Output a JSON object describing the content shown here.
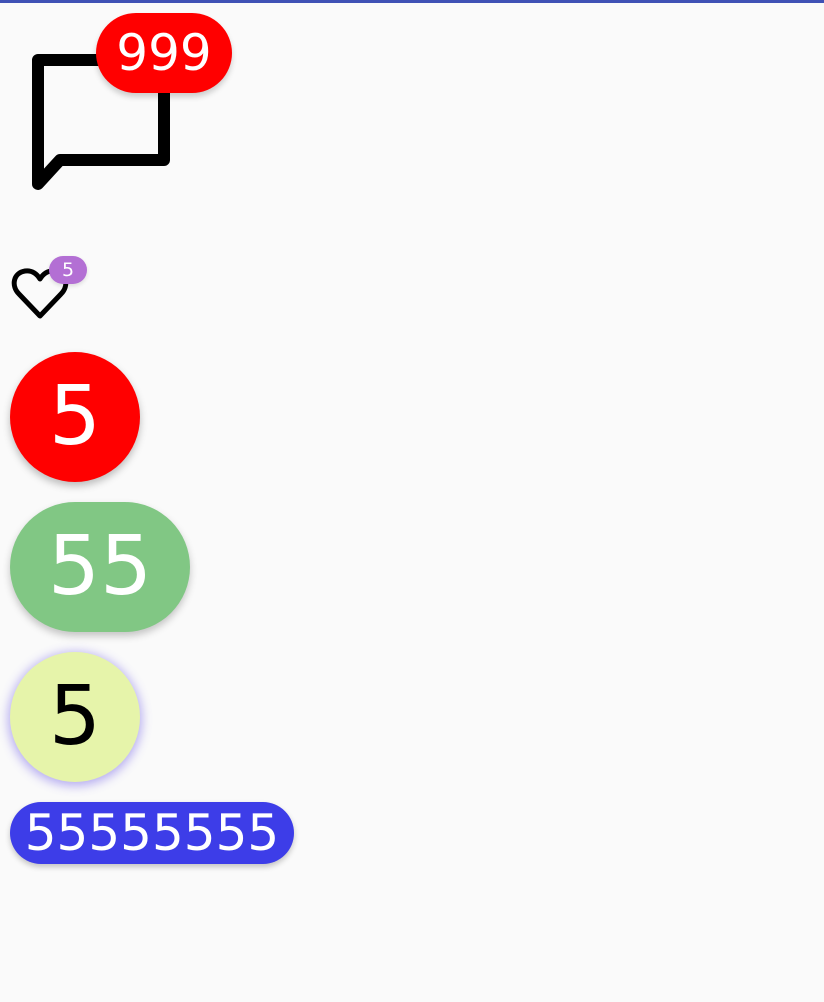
{
  "colors": {
    "top_bar": "#3f51b5",
    "background": "#fafafa",
    "icon_stroke": "#000000"
  },
  "icons": {
    "chat": "chat-bubble-icon",
    "heart": "heart-outline-icon"
  },
  "badges": {
    "chat": {
      "text": "999",
      "background": "#ff0000",
      "text_color": "#ffffff"
    },
    "heart": {
      "text": "5",
      "background": "#b36fd4",
      "text_color": "#ffffff"
    },
    "red": {
      "text": "5",
      "background": "#ff0000",
      "text_color": "#ffffff"
    },
    "green": {
      "text": "55",
      "background": "#81c784",
      "text_color": "#ffffff"
    },
    "yellow": {
      "text": "5",
      "background": "#e6f4aa",
      "text_color": "#000000"
    },
    "blue": {
      "text": "55555555",
      "background": "#3d3de8",
      "text_color": "#ffffff"
    }
  }
}
